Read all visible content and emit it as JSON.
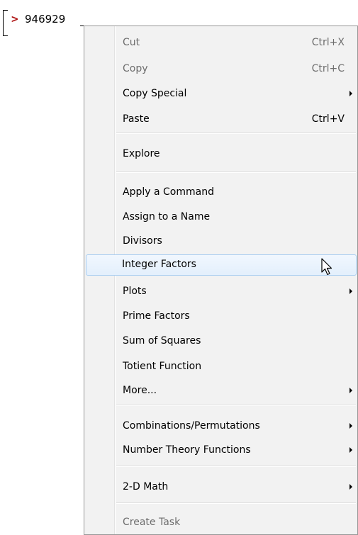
{
  "worksheet": {
    "prompt_symbol": ">",
    "input_value": "946929"
  },
  "menu": {
    "items": [
      {
        "label": "Cut",
        "shortcut": "Ctrl+X",
        "enabled": false
      },
      {
        "label": "Copy",
        "shortcut": "Ctrl+C",
        "enabled": false
      },
      {
        "label": "Copy Special",
        "submenu": true,
        "enabled": true
      },
      {
        "label": "Paste",
        "shortcut": "Ctrl+V",
        "enabled": true
      },
      {
        "label": "Explore",
        "enabled": true
      },
      {
        "label": "Apply a Command",
        "enabled": true
      },
      {
        "label": "Assign to a Name",
        "enabled": true
      },
      {
        "label": "Divisors",
        "enabled": true
      },
      {
        "label": "Integer Factors",
        "enabled": true,
        "highlighted": true
      },
      {
        "label": "Plots",
        "submenu": true,
        "enabled": true
      },
      {
        "label": "Prime Factors",
        "enabled": true
      },
      {
        "label": "Sum of Squares",
        "enabled": true
      },
      {
        "label": "Totient Function",
        "enabled": true
      },
      {
        "label": "More...",
        "submenu": true,
        "enabled": true
      },
      {
        "label": "Combinations/Permutations",
        "submenu": true,
        "enabled": true
      },
      {
        "label": "Number Theory Functions",
        "submenu": true,
        "enabled": true
      },
      {
        "label": "2-D Math",
        "submenu": true,
        "enabled": true
      },
      {
        "label": "Create Task",
        "enabled": false
      }
    ]
  },
  "colors": {
    "prompt_caret": "#b01818",
    "menu_background": "#f2f2f2",
    "highlight_border": "#a8cdf1",
    "disabled_text": "#6d6d6d"
  }
}
